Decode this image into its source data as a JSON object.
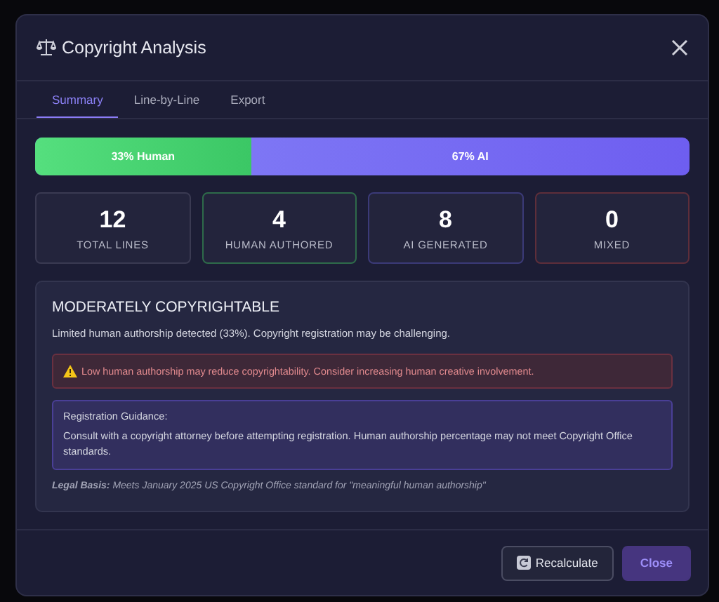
{
  "dialog": {
    "title": "Copyright Analysis"
  },
  "tabs": [
    {
      "label": "Summary",
      "selected": true
    },
    {
      "label": "Line-by-Line",
      "selected": false
    },
    {
      "label": "Export",
      "selected": false
    }
  ],
  "split_bar": {
    "level": 0.33,
    "human_label": "33% Human",
    "ai_label": "67% AI"
  },
  "stats": [
    {
      "value": "12",
      "label": "TOTAL LINES",
      "color": "#3a3a52"
    },
    {
      "value": "4",
      "label": "HUMAN AUTHORED",
      "color": "#2e6b4a"
    },
    {
      "value": "8",
      "label": "AI GENERATED",
      "color": "#3b3a78"
    },
    {
      "value": "0",
      "label": "MIXED",
      "color": "#5e2e3a"
    }
  ],
  "assessment": {
    "heading": "MODERATELY COPYRIGHTABLE",
    "summary": "Limited human authorship detected (33%). Copyright registration may be challenging.",
    "warning": "Low human authorship may reduce copyrightability. Consider increasing human creative involvement.",
    "guidance_title": "Registration Guidance:",
    "guidance_text": "Consult with a copyright attorney before attempting registration. Human authorship percentage may not meet Copyright Office standards.",
    "legal_basis": "**Legal Basis:** Meets January 2025 US Copyright Office standard for \"meaningful human authorship\""
  },
  "buttons": [
    {
      "label": "Recalculate",
      "kind": "secondary"
    },
    {
      "label": "Close",
      "kind": "primary"
    }
  ]
}
